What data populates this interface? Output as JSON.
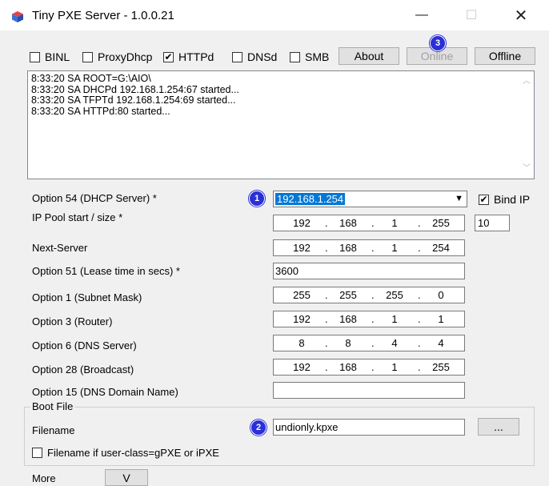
{
  "window": {
    "title": "Tiny PXE Server - 1.0.0.21",
    "minimize_glyph": "—",
    "maximize_glyph": "☐",
    "close_glyph": "✕"
  },
  "toolbar": {
    "binl": {
      "label": "BINL",
      "checked": false
    },
    "proxydhcp": {
      "label": "ProxyDhcp",
      "checked": false
    },
    "httpd": {
      "label": "HTTPd",
      "checked": true
    },
    "dnsd": {
      "label": "DNSd",
      "checked": false
    },
    "smb": {
      "label": "SMB",
      "checked": false
    },
    "about_label": "About",
    "online_label": "Online",
    "offline_label": "Offline"
  },
  "log": {
    "lines": [
      "8:33:20 SA ROOT=G:\\AIO\\",
      "8:33:20 SA DHCPd 192.168.1.254:67 started...",
      "8:33:20 SA TFPTd 192.168.1.254:69 started...",
      "8:33:20 SA HTTPd:80 started..."
    ]
  },
  "form": {
    "opt54": {
      "label": "Option 54 (DHCP Server) *",
      "value": "192.168.1.254"
    },
    "bind_ip": {
      "label": "Bind IP",
      "checked": true
    },
    "pool": {
      "label": "IP Pool start / size *",
      "octets": [
        "192",
        "168",
        "1",
        "255"
      ],
      "size": "10"
    },
    "next_server": {
      "label": "Next-Server",
      "octets": [
        "192",
        "168",
        "1",
        "254"
      ]
    },
    "opt51": {
      "label": "Option 51 (Lease time in secs) *",
      "value": "3600"
    },
    "opt1": {
      "label": "Option 1  (Subnet Mask)",
      "octets": [
        "255",
        "255",
        "255",
        "0"
      ]
    },
    "opt3": {
      "label": "Option 3  (Router)",
      "octets": [
        "192",
        "168",
        "1",
        "1"
      ]
    },
    "opt6": {
      "label": "Option 6  (DNS Server)",
      "octets": [
        "8",
        "8",
        "4",
        "4"
      ]
    },
    "opt28": {
      "label": "Option 28 (Broadcast)",
      "octets": [
        "192",
        "168",
        "1",
        "255"
      ]
    },
    "opt15": {
      "label": "Option 15 (DNS Domain Name)",
      "value": ""
    }
  },
  "bootfile": {
    "group_title": "Boot File",
    "filename_label": "Filename",
    "filename_value": "undionly.kpxe",
    "browse_label": "...",
    "userclass_label": "Filename if user-class=gPXE or iPXE",
    "userclass_checked": false
  },
  "more": {
    "label": "More",
    "button_label": "V"
  },
  "badges": {
    "b1": "1",
    "b2": "2",
    "b3": "3"
  },
  "colors": {
    "badge": "#2a2fd6",
    "selection": "#0078d7"
  }
}
